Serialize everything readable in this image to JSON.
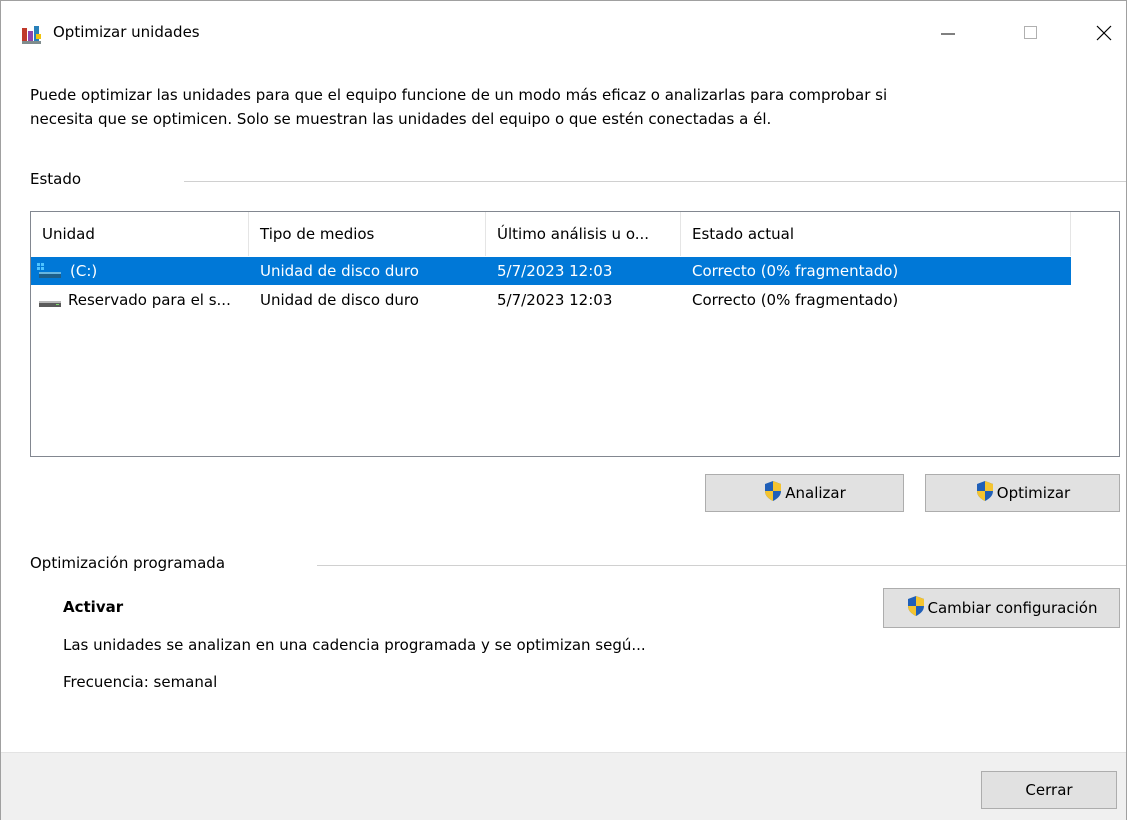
{
  "window": {
    "title": "Optimizar unidades",
    "controls": {
      "minimize": "—",
      "maximize": "☐",
      "close": "✕"
    }
  },
  "description": {
    "line1": "Puede optimizar las unidades para que el equipo funcione de un modo más eficaz o analizarlas para comprobar si",
    "line2": "necesita que se optimicen. Solo se muestran las unidades del equipo o que estén conectadas a él."
  },
  "status_group": {
    "label": "Estado"
  },
  "drives_list": {
    "columns": [
      "Unidad",
      "Tipo de medios",
      "Último análisis u o...",
      "Estado actual"
    ],
    "rows": [
      {
        "unidad": "(C:)",
        "tipo": "Unidad de disco duro",
        "ultimo": "5/7/2023 12:03",
        "estado": "Correcto (0% fragmentado)",
        "icon": "system-drive-icon",
        "selected": true
      },
      {
        "unidad": "Reservado para el s...",
        "tipo": "Unidad de disco duro",
        "ultimo": "5/7/2023 12:03",
        "estado": "Correcto (0% fragmentado)",
        "icon": "drive-icon",
        "selected": false
      }
    ]
  },
  "actions": {
    "analyze": "Analizar",
    "optimize": "Optimizar"
  },
  "scheduled": {
    "label": "Optimización programada",
    "state": "Activar",
    "detail": "Las unidades se analizan en una cadencia programada y se optimizan segú...",
    "frequency": "Frecuencia: semanal",
    "change_button": "Cambiar configuración"
  },
  "footer": {
    "close_button": "Cerrar"
  },
  "colors": {
    "selection": "#0078d7",
    "button_bg": "#e1e1e1",
    "footer_bg": "#f0f0f0"
  }
}
